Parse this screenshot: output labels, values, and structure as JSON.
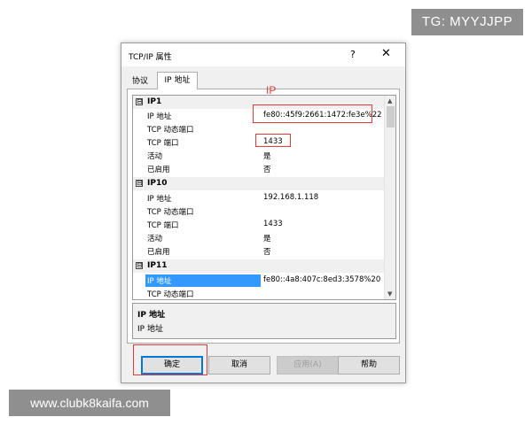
{
  "watermarks": {
    "top_right": "TG: MYYJJPP",
    "bottom_left": "www.clubk8kaifa.com"
  },
  "dialog": {
    "title": "TCP/IP 属性",
    "help_glyph": "?",
    "close_glyph": "✕"
  },
  "tabs": [
    {
      "label": "协议"
    },
    {
      "label": "IP 地址"
    }
  ],
  "properties": {
    "groups": [
      {
        "name": "IP1",
        "rows": [
          {
            "name": "IP 地址",
            "value": "fe80::45f9:2661:1472:fe3e%22"
          },
          {
            "name": "TCP 动态端口",
            "value": ""
          },
          {
            "name": "TCP 端口",
            "value": "1433"
          },
          {
            "name": "活动",
            "value": "是"
          },
          {
            "name": "已启用",
            "value": "否"
          }
        ]
      },
      {
        "name": "IP10",
        "rows": [
          {
            "name": "IP 地址",
            "value": "192.168.1.118"
          },
          {
            "name": "TCP 动态端口",
            "value": ""
          },
          {
            "name": "TCP 端口",
            "value": "1433"
          },
          {
            "name": "活动",
            "value": "是"
          },
          {
            "name": "已启用",
            "value": "否"
          }
        ]
      },
      {
        "name": "IP11",
        "rows": [
          {
            "name": "IP 地址",
            "value": "fe80::4a8:407c:8ed3:3578%20"
          },
          {
            "name": "TCP 动态端口",
            "value": ""
          }
        ]
      }
    ],
    "collapse_glyph": "⊟"
  },
  "description": {
    "title": "IP 地址",
    "text": "IP 地址"
  },
  "buttons": {
    "ok": "确定",
    "cancel": "取消",
    "apply": "应用(A)",
    "help": "帮助"
  },
  "annotation": {
    "label": "IP"
  },
  "colors": {
    "selection": "#3399ff",
    "annotation": "#e03c3c",
    "accent_border": "#0078d7"
  }
}
